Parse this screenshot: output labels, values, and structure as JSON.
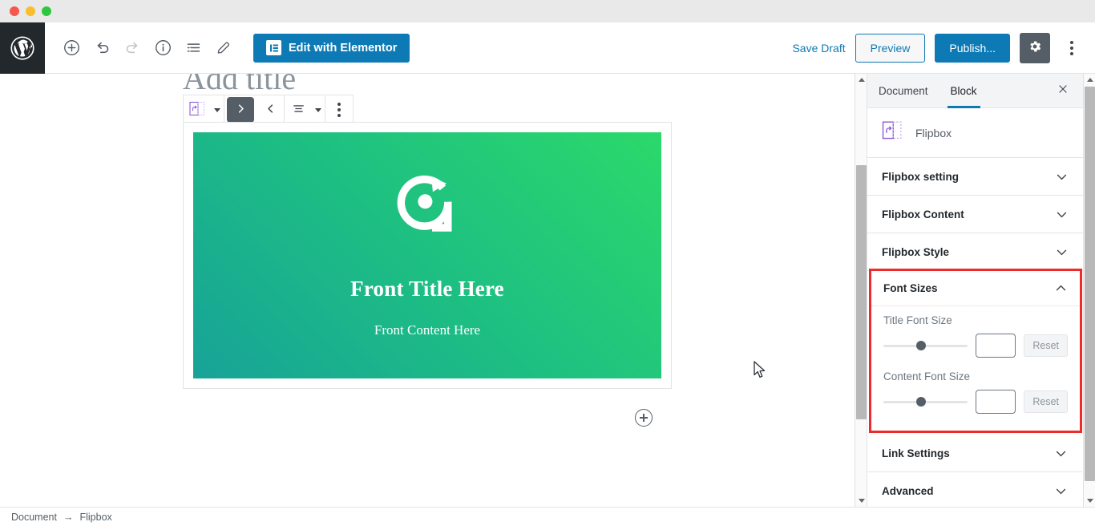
{
  "window": {
    "controls": [
      "close",
      "minimize",
      "maximize"
    ]
  },
  "toolbar": {
    "logo_icon": "wordpress-logo-icon",
    "left_buttons": [
      {
        "name": "add-block-button",
        "icon": "plus-circle-icon",
        "enabled": true
      },
      {
        "name": "undo-button",
        "icon": "undo-arrow-icon",
        "enabled": true
      },
      {
        "name": "redo-button",
        "icon": "redo-arrow-icon",
        "enabled": false
      },
      {
        "name": "content-info-button",
        "icon": "info-circle-icon",
        "enabled": true
      },
      {
        "name": "block-navigation-button",
        "icon": "list-view-icon",
        "enabled": true
      },
      {
        "name": "edit-mode-button",
        "icon": "pencil-icon",
        "enabled": true
      }
    ],
    "elementor_label": "Edit with Elementor",
    "elementor_icon": "elementor-logo-icon",
    "save_draft_label": "Save Draft",
    "preview_label": "Preview",
    "publish_label": "Publish...",
    "settings_icon": "gear-icon",
    "more_icon": "kebab-menu-icon",
    "accent_color": "#0e7ab5"
  },
  "block_toolbar": {
    "block_type_icon": "flipbox-block-icon",
    "block_type_caret": "chevron-down-icon",
    "move_up_icon": "chevron-right-icon",
    "move_down_icon": "chevron-left-icon",
    "align_icon": "align-center-icon",
    "align_caret": "chevron-down-icon",
    "more_options_icon": "kebab-menu-icon"
  },
  "editor": {
    "post_title_placeholder": "Add title",
    "add_block_icon": "plus-circle-icon",
    "flipbox": {
      "icon": "rotate-circle-arrow-icon",
      "title": "Front Title Here",
      "content": "Front Content Here",
      "gradient_start": "#17a398",
      "gradient_end": "#2bd96a"
    }
  },
  "sidebar": {
    "tabs": [
      {
        "label": "Document",
        "active": false
      },
      {
        "label": "Block",
        "active": true
      }
    ],
    "close_icon": "close-icon",
    "block_name": "Flipbox",
    "block_icon": "flipbox-block-icon",
    "panels": [
      {
        "label": "Flipbox setting",
        "expanded": false,
        "icon": "chevron-down-icon"
      },
      {
        "label": "Flipbox Content",
        "expanded": false,
        "icon": "chevron-down-icon"
      },
      {
        "label": "Flipbox Style",
        "expanded": false,
        "icon": "chevron-down-icon"
      }
    ],
    "font_sizes_panel": {
      "label": "Font Sizes",
      "expanded": true,
      "collapse_icon": "chevron-up-icon",
      "highlight_color": "#ee2b2b",
      "controls": [
        {
          "label": "Title Font Size",
          "slider_percent": 45,
          "input_value": "",
          "input_placeholder": "",
          "reset_label": "Reset"
        },
        {
          "label": "Content Font Size",
          "slider_percent": 45,
          "input_value": "",
          "input_placeholder": "",
          "reset_label": "Reset"
        }
      ]
    },
    "bottom_panels": [
      {
        "label": "Link Settings",
        "expanded": false,
        "icon": "chevron-down-icon"
      },
      {
        "label": "Advanced",
        "expanded": false,
        "icon": "chevron-down-icon"
      }
    ]
  },
  "status_bar": {
    "root_label": "Document",
    "separator": "→",
    "current_label": "Flipbox"
  }
}
